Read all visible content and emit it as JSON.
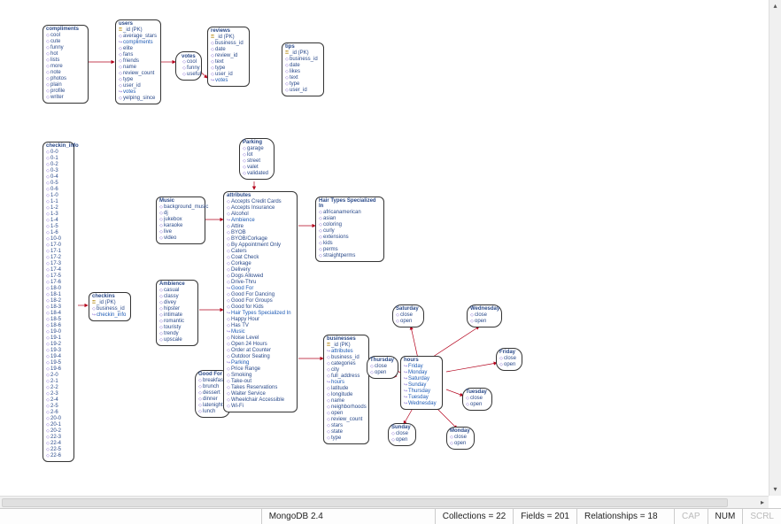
{
  "statusbar": {
    "engine": "MongoDB 2.4",
    "collections_label": "Collections = 22",
    "fields_label": "Fields = 201",
    "relationships_label": "Relationships = 18",
    "cap": "CAP",
    "num": "NUM",
    "scrl": "SCRL"
  },
  "boxes": {
    "compliments": {
      "title": "compliments",
      "fields": [
        "cool",
        "cute",
        "funny",
        "hot",
        "lists",
        "more",
        "note",
        "photos",
        "plain",
        "profile",
        "writer"
      ]
    },
    "users": {
      "title": "users",
      "fields": [
        {
          "label": "_id (PK)",
          "key": true
        },
        {
          "label": "average_stars"
        },
        {
          "label": "compliments",
          "link": true
        },
        {
          "label": "elite"
        },
        {
          "label": "fans"
        },
        {
          "label": "friends"
        },
        {
          "label": "name"
        },
        {
          "label": "review_count"
        },
        {
          "label": "type"
        },
        {
          "label": "user_id"
        },
        {
          "label": "votes",
          "link": true
        },
        {
          "label": "yelping_since"
        }
      ]
    },
    "votes": {
      "title": "votes",
      "fields": [
        "cool",
        "funny",
        "useful"
      ]
    },
    "reviews": {
      "title": "reviews",
      "fields": [
        {
          "label": "_id (PK)",
          "key": true
        },
        {
          "label": "business_id"
        },
        {
          "label": "date"
        },
        {
          "label": "review_id"
        },
        {
          "label": "text"
        },
        {
          "label": "type"
        },
        {
          "label": "user_id"
        },
        {
          "label": "votes",
          "link": true
        }
      ]
    },
    "tips": {
      "title": "tips",
      "fields": [
        {
          "label": "_id (PK)",
          "key": true
        },
        {
          "label": "business_id"
        },
        {
          "label": "date"
        },
        {
          "label": "likes"
        },
        {
          "label": "text"
        },
        {
          "label": "type"
        },
        {
          "label": "user_id"
        }
      ]
    },
    "checkin_info": {
      "title": "checkin_info",
      "fields": [
        "0-0",
        "0-1",
        "0-2",
        "0-3",
        "0-4",
        "0-5",
        "0-6",
        "1-0",
        "1-1",
        "1-2",
        "1-3",
        "1-4",
        "1-5",
        "1-6",
        "10-0",
        "17-0",
        "17-1",
        "17-2",
        "17-3",
        "17-4",
        "17-5",
        "17-6",
        "18-0",
        "18-1",
        "18-2",
        "18-3",
        "18-4",
        "18-5",
        "18-6",
        "19-0",
        "19-1",
        "19-2",
        "19-3",
        "19-4",
        "19-5",
        "19-6",
        "2-0",
        "2-1",
        "2-2",
        "2-3",
        "2-4",
        "2-5",
        "2-6",
        "20-0",
        "20-1",
        "20-2",
        "22-3",
        "22-4",
        "22-5",
        "22-6"
      ]
    },
    "checkins": {
      "title": "checkins",
      "fields": [
        {
          "label": "_id (PK)",
          "key": true
        },
        {
          "label": "business_id"
        },
        {
          "label": "checkin_info",
          "link": true
        }
      ]
    },
    "music": {
      "title": "Music",
      "fields": [
        "background_music",
        "dj",
        "jukebox",
        "karaoke",
        "live",
        "video"
      ]
    },
    "ambience": {
      "title": "Ambience",
      "fields": [
        "casual",
        "classy",
        "divey",
        "hipster",
        "intimate",
        "romantic",
        "touristy",
        "trendy",
        "upscale"
      ]
    },
    "goodfor": {
      "title": "Good For",
      "fields": [
        "breakfast",
        "brunch",
        "dessert",
        "dinner",
        "latenight",
        "lunch"
      ]
    },
    "parking": {
      "title": "Parking",
      "fields": [
        "garage",
        "lot",
        "street",
        "valet",
        "validated"
      ]
    },
    "attributes": {
      "title": "attributes",
      "fields": [
        {
          "label": "Accepts Credit Cards"
        },
        {
          "label": "Accepts Insurance"
        },
        {
          "label": "Alcohol"
        },
        {
          "label": "Ambience",
          "link": true
        },
        {
          "label": "Attire"
        },
        {
          "label": "BYOB"
        },
        {
          "label": "BYOB/Corkage"
        },
        {
          "label": "By Appointment Only"
        },
        {
          "label": "Caters"
        },
        {
          "label": "Coat Check"
        },
        {
          "label": "Corkage"
        },
        {
          "label": "Delivery"
        },
        {
          "label": "Dogs Allowed"
        },
        {
          "label": "Drive-Thru"
        },
        {
          "label": "Good For",
          "link": true
        },
        {
          "label": "Good For Dancing"
        },
        {
          "label": "Good For Groups"
        },
        {
          "label": "Good for Kids"
        },
        {
          "label": "Hair Types Specialized In",
          "link": true
        },
        {
          "label": "Happy Hour"
        },
        {
          "label": "Has TV"
        },
        {
          "label": "Music",
          "link": true
        },
        {
          "label": "Noise Level"
        },
        {
          "label": "Open 24 Hours"
        },
        {
          "label": "Order at Counter"
        },
        {
          "label": "Outdoor Seating"
        },
        {
          "label": "Parking",
          "link": true
        },
        {
          "label": "Price Range"
        },
        {
          "label": "Smoking"
        },
        {
          "label": "Take-out"
        },
        {
          "label": "Takes Reservations"
        },
        {
          "label": "Waiter Service"
        },
        {
          "label": "Wheelchair Accessible"
        },
        {
          "label": "Wi-Fi"
        }
      ]
    },
    "hairtypes": {
      "title": "Hair Types Specialized In",
      "fields": [
        "africanamerican",
        "asian",
        "coloring",
        "curly",
        "extensions",
        "kids",
        "perms",
        "straightperms"
      ]
    },
    "businesses": {
      "title": "businesses",
      "fields": [
        {
          "label": "_id (PK)",
          "key": true
        },
        {
          "label": "attributes",
          "link": true
        },
        {
          "label": "business_id"
        },
        {
          "label": "categories"
        },
        {
          "label": "city"
        },
        {
          "label": "full_address"
        },
        {
          "label": "hours",
          "link": true
        },
        {
          "label": "latitude"
        },
        {
          "label": "longitude"
        },
        {
          "label": "name"
        },
        {
          "label": "neighborhoods"
        },
        {
          "label": "open"
        },
        {
          "label": "review_count"
        },
        {
          "label": "stars"
        },
        {
          "label": "state"
        },
        {
          "label": "type"
        }
      ]
    },
    "hours": {
      "title": "hours",
      "fields": [
        {
          "label": "Friday",
          "link": true
        },
        {
          "label": "Monday",
          "link": true
        },
        {
          "label": "Saturday",
          "link": true
        },
        {
          "label": "Sunday",
          "link": true
        },
        {
          "label": "Thursday",
          "link": true
        },
        {
          "label": "Tuesday",
          "link": true
        },
        {
          "label": "Wednesday",
          "link": true
        }
      ]
    },
    "saturday": {
      "title": "Saturday",
      "fields": [
        "close",
        "open"
      ]
    },
    "wednesday": {
      "title": "Wednesday",
      "fields": [
        "close",
        "open"
      ]
    },
    "thursday": {
      "title": "Thursday",
      "fields": [
        "close",
        "open"
      ]
    },
    "friday": {
      "title": "Friday",
      "fields": [
        "close",
        "open"
      ]
    },
    "tuesday": {
      "title": "Tuesday",
      "fields": [
        "close",
        "open"
      ]
    },
    "sunday": {
      "title": "Sunday",
      "fields": [
        "close",
        "open"
      ]
    },
    "monday": {
      "title": "Monday",
      "fields": [
        "close",
        "open"
      ]
    }
  }
}
